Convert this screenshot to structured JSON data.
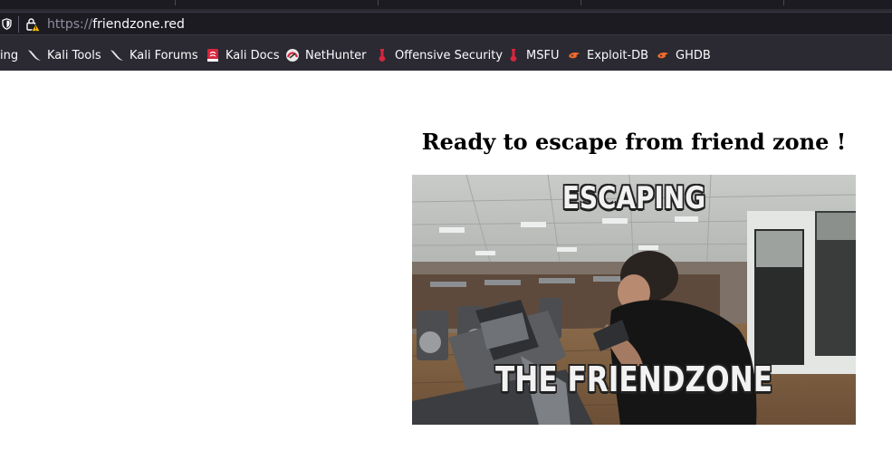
{
  "browser": {
    "url_scheme": "https://",
    "url_host": "friendzone.red",
    "bookmarks": [
      {
        "label": "ing",
        "icon": "none"
      },
      {
        "label": "Kali Tools",
        "icon": "kali-dragon-icon"
      },
      {
        "label": "Kali Forums",
        "icon": "kali-dragon-icon"
      },
      {
        "label": "Kali Docs",
        "icon": "kali-docs-icon"
      },
      {
        "label": "NetHunter",
        "icon": "nethunter-icon"
      },
      {
        "label": "Offensive Security",
        "icon": "offsec-icon"
      },
      {
        "label": "MSFU",
        "icon": "offsec-icon"
      },
      {
        "label": "Exploit-DB",
        "icon": "exploitdb-icon"
      },
      {
        "label": "GHDB",
        "icon": "exploitdb-icon"
      }
    ]
  },
  "page": {
    "heading": "Ready to escape from friend zone !",
    "meme": {
      "top_text": "ESCAPING",
      "bottom_text": "THE FRIENDZONE"
    }
  },
  "colors": {
    "toolbar_bg": "#2b2a33",
    "urlbar_bg": "#1c1b22",
    "page_bg": "#ffffff"
  }
}
